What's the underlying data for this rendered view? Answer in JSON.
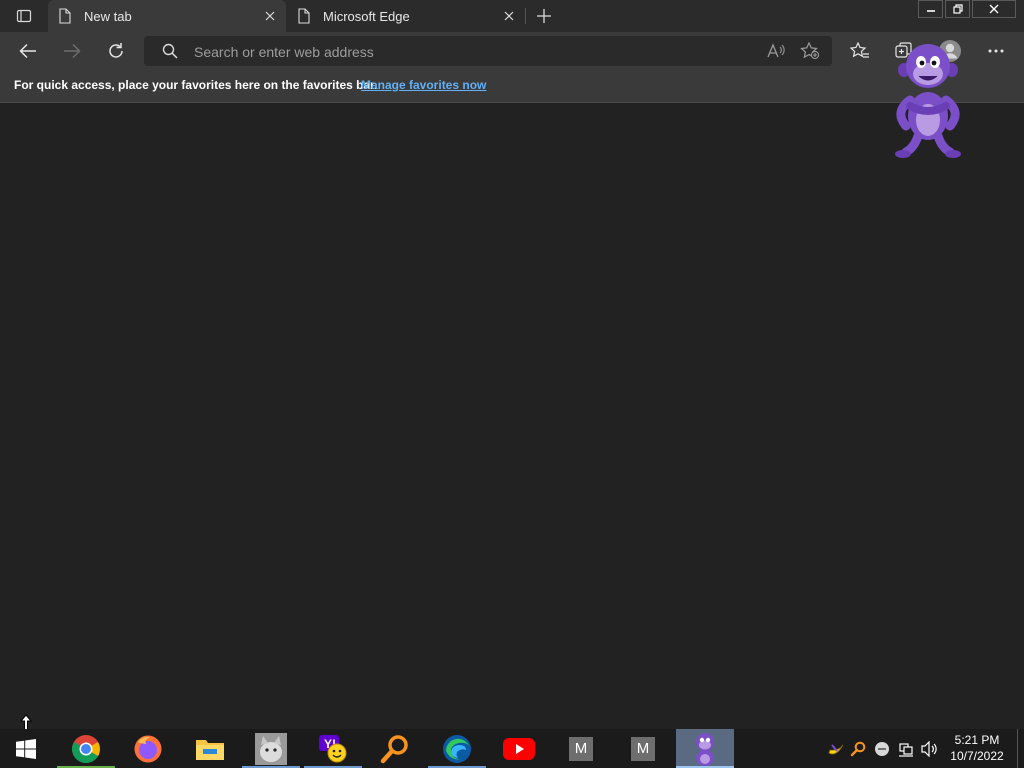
{
  "tabs": [
    {
      "title": "New tab",
      "active": true
    },
    {
      "title": "Microsoft Edge",
      "active": false
    }
  ],
  "toolbar": {
    "address_placeholder": "Search or enter web address",
    "address_value": ""
  },
  "favorites_bar": {
    "message": "For quick access, place your favorites here on the favorites bar.",
    "link": "Manage favorites now"
  },
  "taskbar": {
    "pinned": [
      {
        "name": "Google Chrome",
        "icon": "chrome-icon"
      },
      {
        "name": "Firefox",
        "icon": "firefox-icon"
      },
      {
        "name": "File Explorer",
        "icon": "folder-icon"
      },
      {
        "name": "Cat app",
        "icon": "cat-icon"
      },
      {
        "name": "Yahoo Messenger",
        "icon": "yahoo-messenger-icon"
      },
      {
        "name": "Search tool",
        "icon": "magnifier-icon"
      },
      {
        "name": "Microsoft Edge",
        "icon": "edge-icon"
      },
      {
        "name": "YouTube",
        "icon": "youtube-icon"
      },
      {
        "name": "M app 1",
        "icon": "m-app-icon",
        "label": "M"
      },
      {
        "name": "M app 2",
        "icon": "m-app-icon",
        "label": "M"
      },
      {
        "name": "BonziBuddy",
        "icon": "bonzi-icon"
      }
    ],
    "clock": {
      "time": "5:21 PM",
      "date": "10/7/2022"
    }
  },
  "colors": {
    "background": "#222222",
    "toolbar": "#3a3a3a",
    "link": "#62b0f5",
    "taskbar": "#1b1b1b",
    "bonzi_purple": "#7b4fc7"
  }
}
